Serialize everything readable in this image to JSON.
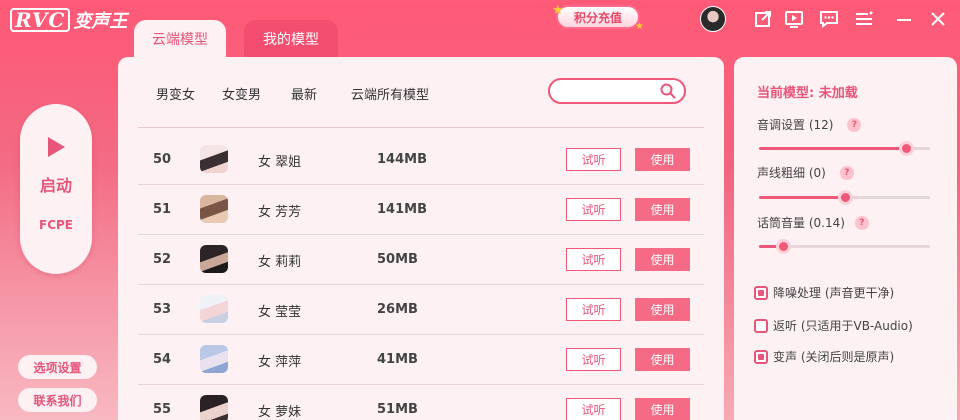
{
  "app": {
    "logo_latin": "RVC",
    "logo_cn": "变声王"
  },
  "topbar": {
    "points_button": "积分充值"
  },
  "tabs": [
    {
      "label": "云端模型",
      "active": true
    },
    {
      "label": "我的模型",
      "active": false
    }
  ],
  "left": {
    "start_label": "启动",
    "algo_label": "FCPE",
    "options_button": "选项设置",
    "contact_button": "联系我们"
  },
  "categories": [
    "男变女",
    "女变男",
    "最新",
    "云端所有模型"
  ],
  "search": {
    "placeholder": ""
  },
  "models": [
    {
      "num": "50",
      "name": "女 翠姐",
      "size": "144MB",
      "try": "试听",
      "use": "使用"
    },
    {
      "num": "51",
      "name": "女 芳芳",
      "size": "141MB",
      "try": "试听",
      "use": "使用"
    },
    {
      "num": "52",
      "name": "女 莉莉",
      "size": "50MB",
      "try": "试听",
      "use": "使用"
    },
    {
      "num": "53",
      "name": "女 莹莹",
      "size": "26MB",
      "try": "试听",
      "use": "使用"
    },
    {
      "num": "54",
      "name": "女 萍萍",
      "size": "41MB",
      "try": "试听",
      "use": "使用"
    },
    {
      "num": "55",
      "name": "女 萝妹",
      "size": "51MB",
      "try": "试听",
      "use": "使用"
    }
  ],
  "settings": {
    "current_model_label": "当前模型: 未加载",
    "pitch_label": "音调设置 (12)",
    "pitch_fraction": 0.86,
    "thickness_label": "声线粗细 (0)",
    "thickness_fraction": 0.5,
    "mic_label": "话筒音量 (0.14)",
    "mic_fraction": 0.14,
    "help": "?",
    "denoise_label": "降噪处理 (声音更干净)",
    "denoise_checked": true,
    "monitor_label": "返听 (只适用于VB-Audio)",
    "monitor_checked": false,
    "voice_change_label": "变声 (关闭后则是原声)",
    "voice_change_checked": true
  },
  "colors": {
    "accent": "#e8557a",
    "brand_pink": "#ff5a78",
    "panel": "#fdf1f3"
  }
}
